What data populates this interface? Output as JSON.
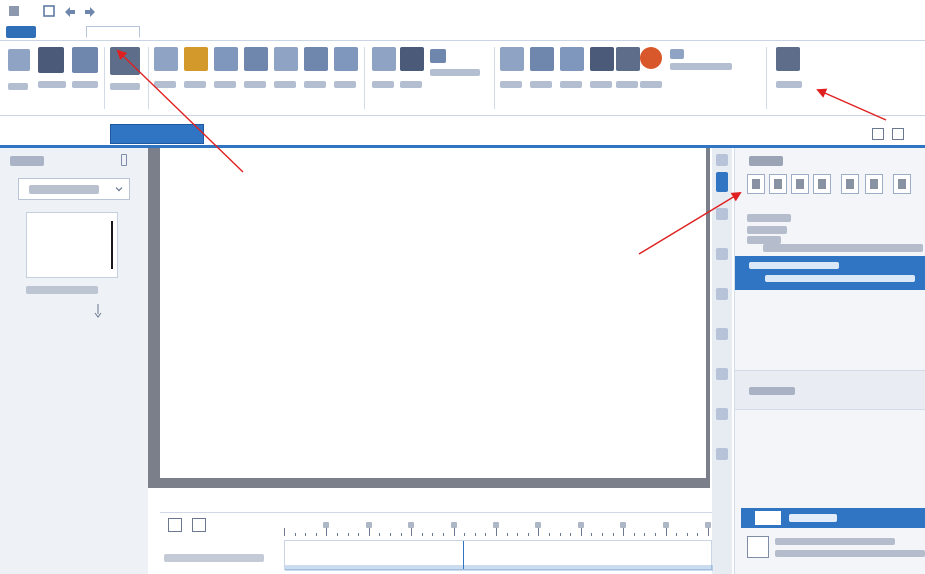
{
  "window": {
    "title": ""
  },
  "quick_access": [
    {
      "icon": "app-menu-icon"
    },
    {
      "icon": "save-icon"
    },
    {
      "icon": "undo-icon"
    },
    {
      "icon": "redo-icon"
    }
  ],
  "ribbon": {
    "file_tab": "",
    "tabs": [
      "",
      "",
      "",
      "",
      "",
      "",
      "",
      ""
    ],
    "active_tab_index": 1
  },
  "document_tabs": [
    {
      "label": "",
      "active": false
    },
    {
      "label": "",
      "active": true
    }
  ],
  "left_panel": {
    "title": "",
    "dropdown_value": "",
    "thumbnail_label": ""
  },
  "bottom_panel": {
    "tabs": [
      "",
      "",
      ""
    ],
    "zoom_label": ""
  },
  "right_panel": {
    "title": "",
    "section_label": "",
    "bottom_bar_label": ""
  },
  "colors": {
    "accent": "#2f75c4",
    "arrow": "#e02020",
    "canvas_border": "#7a7f89"
  }
}
